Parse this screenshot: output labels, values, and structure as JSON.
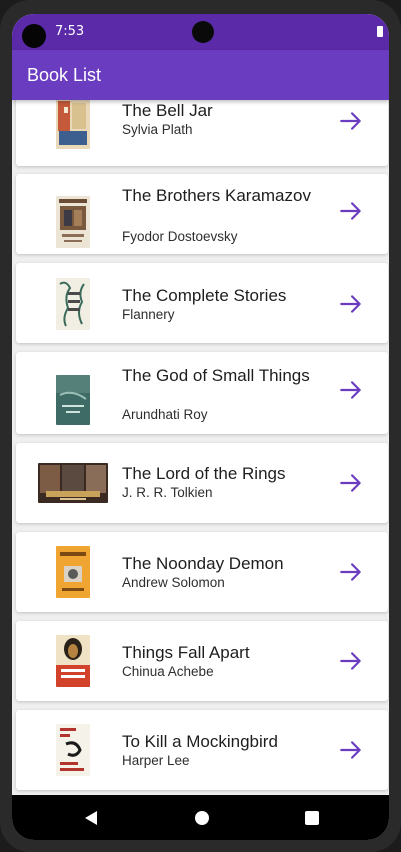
{
  "status_bar": {
    "time": "7:53"
  },
  "app_bar": {
    "title": "Book List"
  },
  "books": [
    {
      "title": "The Bell Jar",
      "author": "Sylvia Plath"
    },
    {
      "title": "The Brothers Karamazov",
      "author": "Fyodor Dostoevsky"
    },
    {
      "title": "The Complete Stories",
      "author": "Flannery"
    },
    {
      "title": "The God of Small Things",
      "author": "Arundhati Roy"
    },
    {
      "title": "The Lord of the Rings",
      "author": "J. R. R. Tolkien"
    },
    {
      "title": "The Noonday Demon",
      "author": "Andrew Solomon"
    },
    {
      "title": "Things Fall Apart",
      "author": "Chinua Achebe"
    },
    {
      "title": "To Kill a Mockingbird",
      "author": "Harper Lee"
    }
  ],
  "colors": {
    "status_bar": "#5b2aa8",
    "app_bar": "#6a3cc0",
    "arrow": "#6a3cc0"
  },
  "icons": {
    "row_action": "arrow-forward-icon",
    "nav_back": "back-triangle-icon",
    "nav_home": "home-circle-icon",
    "nav_recents": "recents-square-icon"
  }
}
